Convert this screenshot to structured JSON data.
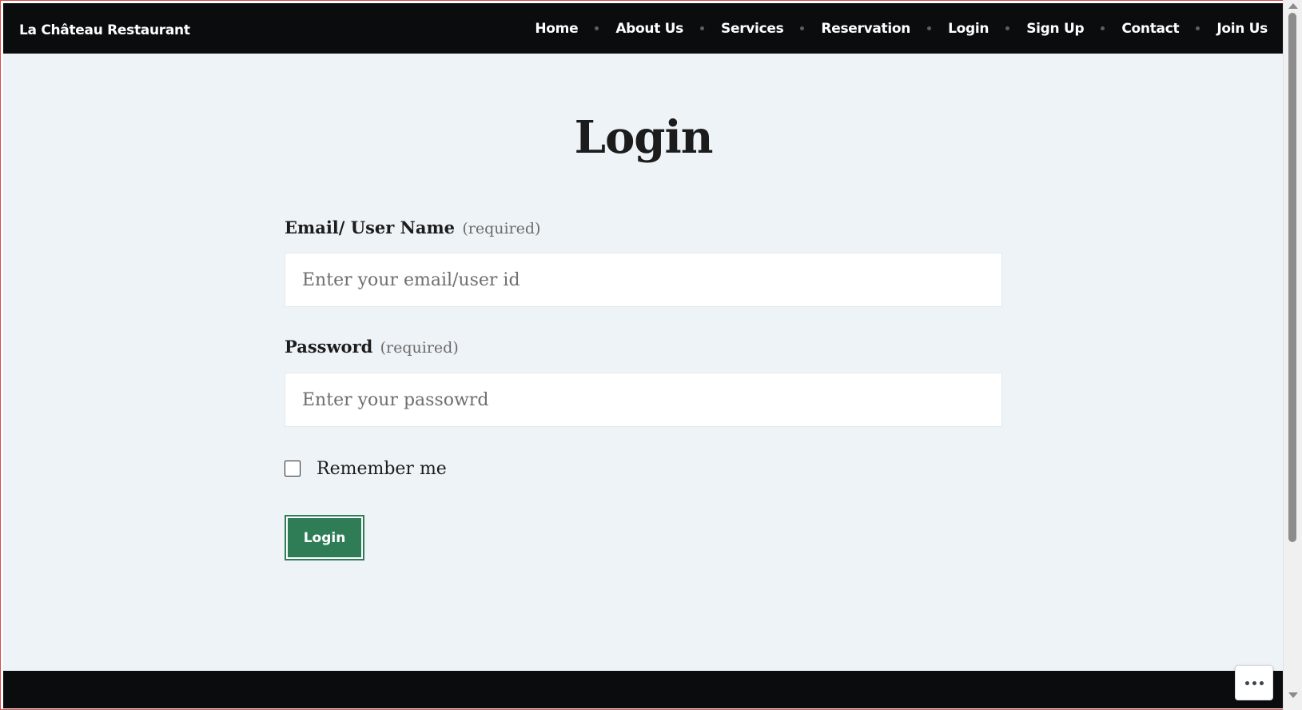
{
  "site": {
    "brand": "La Château Restaurant"
  },
  "nav": {
    "items": [
      {
        "label": "Home"
      },
      {
        "label": "About Us"
      },
      {
        "label": "Services"
      },
      {
        "label": "Reservation"
      },
      {
        "label": "Login"
      },
      {
        "label": "Sign Up"
      },
      {
        "label": "Contact"
      },
      {
        "label": "Join Us"
      }
    ]
  },
  "page": {
    "title": "Login"
  },
  "form": {
    "email": {
      "label": "Email/ User Name",
      "required_text": "(required)",
      "placeholder": "Enter your email/user id",
      "value": ""
    },
    "password": {
      "label": "Password",
      "required_text": "(required)",
      "placeholder": "Enter your passowrd",
      "value": ""
    },
    "remember": {
      "label": "Remember me",
      "checked": false
    },
    "submit_label": "Login"
  },
  "icons": {
    "more_options": "more-horizontal-icon"
  },
  "colors": {
    "header_bg": "#0b0c0e",
    "page_bg": "#eef3f7",
    "button_green": "#2f7d57",
    "text_dark": "#1c1c1c",
    "muted_text": "#6b6b6b"
  }
}
